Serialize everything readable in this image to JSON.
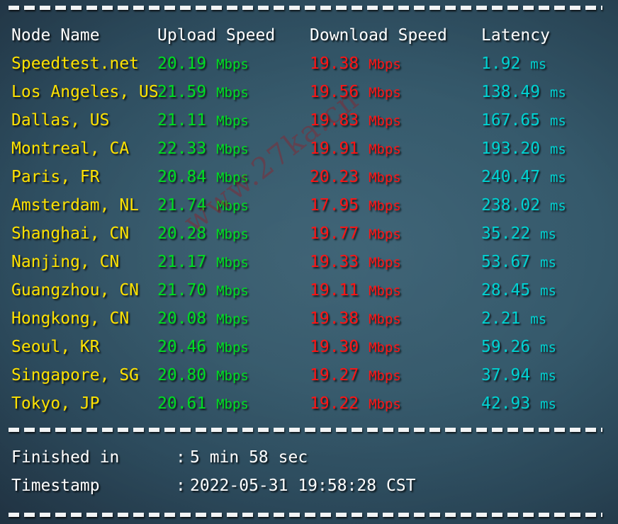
{
  "watermark": "www.27ka.cn",
  "colors": {
    "background": "#35596b",
    "header_text": "#ffffff",
    "node_name": "#ffe200",
    "upload": "#00dd22",
    "download": "#ff1414",
    "latency": "#00d2d2",
    "separator": "#f2f4f5",
    "watermark": "#961c26"
  },
  "table": {
    "headers": {
      "node": "Node Name",
      "upload": "Upload Speed",
      "download": "Download Speed",
      "latency": "Latency"
    },
    "rows": [
      {
        "node": "Speedtest.net",
        "upload": "20.19",
        "upload_unit": "Mbps",
        "download": "19.38",
        "download_unit": "Mbps",
        "latency": "1.92",
        "latency_unit": "ms"
      },
      {
        "node": "Los Angeles, US",
        "upload": "21.59",
        "upload_unit": "Mbps",
        "download": "19.56",
        "download_unit": "Mbps",
        "latency": "138.49",
        "latency_unit": "ms"
      },
      {
        "node": "Dallas, US",
        "upload": "21.11",
        "upload_unit": "Mbps",
        "download": "19.83",
        "download_unit": "Mbps",
        "latency": "167.65",
        "latency_unit": "ms"
      },
      {
        "node": "Montreal, CA",
        "upload": "22.33",
        "upload_unit": "Mbps",
        "download": "19.91",
        "download_unit": "Mbps",
        "latency": "193.20",
        "latency_unit": "ms"
      },
      {
        "node": "Paris, FR",
        "upload": "20.84",
        "upload_unit": "Mbps",
        "download": "20.23",
        "download_unit": "Mbps",
        "latency": "240.47",
        "latency_unit": "ms"
      },
      {
        "node": "Amsterdam, NL",
        "upload": "21.74",
        "upload_unit": "Mbps",
        "download": "17.95",
        "download_unit": "Mbps",
        "latency": "238.02",
        "latency_unit": "ms"
      },
      {
        "node": "Shanghai, CN",
        "upload": "20.28",
        "upload_unit": "Mbps",
        "download": "19.77",
        "download_unit": "Mbps",
        "latency": "35.22",
        "latency_unit": "ms"
      },
      {
        "node": "Nanjing, CN",
        "upload": "21.17",
        "upload_unit": "Mbps",
        "download": "19.33",
        "download_unit": "Mbps",
        "latency": "53.67",
        "latency_unit": "ms"
      },
      {
        "node": "Guangzhou, CN",
        "upload": "21.70",
        "upload_unit": "Mbps",
        "download": "19.11",
        "download_unit": "Mbps",
        "latency": "28.45",
        "latency_unit": "ms"
      },
      {
        "node": "Hongkong, CN",
        "upload": "20.08",
        "upload_unit": "Mbps",
        "download": "19.38",
        "download_unit": "Mbps",
        "latency": "2.21",
        "latency_unit": "ms"
      },
      {
        "node": "Seoul, KR",
        "upload": "20.46",
        "upload_unit": "Mbps",
        "download": "19.30",
        "download_unit": "Mbps",
        "latency": "59.26",
        "latency_unit": "ms"
      },
      {
        "node": "Singapore, SG",
        "upload": "20.80",
        "upload_unit": "Mbps",
        "download": "19.27",
        "download_unit": "Mbps",
        "latency": "37.94",
        "latency_unit": "ms"
      },
      {
        "node": "Tokyo, JP",
        "upload": "20.61",
        "upload_unit": "Mbps",
        "download": "19.22",
        "download_unit": "Mbps",
        "latency": "42.93",
        "latency_unit": "ms"
      }
    ]
  },
  "footer": {
    "rows": [
      {
        "label": "Finished in",
        "colon": ":",
        "value": "5 min 58 sec"
      },
      {
        "label": "Timestamp",
        "colon": ":",
        "value": "2022-05-31 19:58:28 CST"
      }
    ]
  }
}
